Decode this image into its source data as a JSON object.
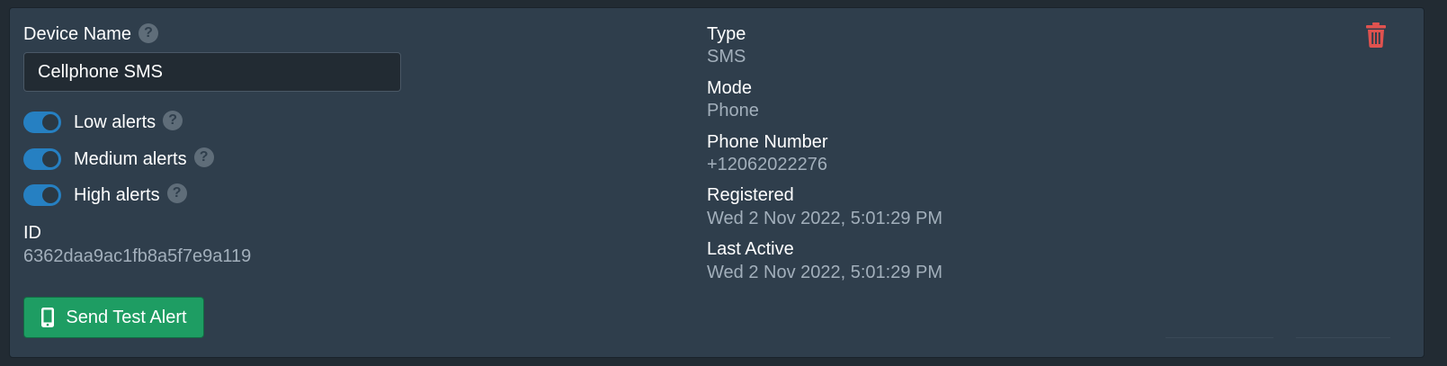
{
  "device": {
    "name_label": "Device Name",
    "name_value": "Cellphone SMS",
    "help_glyph": "?"
  },
  "alerts": [
    {
      "label": "Low alerts",
      "enabled": true
    },
    {
      "label": "Medium alerts",
      "enabled": true
    },
    {
      "label": "High alerts",
      "enabled": true
    }
  ],
  "id": {
    "label": "ID",
    "value": "6362daa9ac1fb8a5f7e9a119"
  },
  "send_button": {
    "label": "Send Test Alert",
    "icon": "mobile-phone-icon"
  },
  "details": {
    "type_label": "Type",
    "type_value": "SMS",
    "mode_label": "Mode",
    "mode_value": "Phone",
    "phone_label": "Phone Number",
    "phone_value": "+12062022276",
    "registered_label": "Registered",
    "registered_value": "Wed 2 Nov 2022, 5:01:29 PM",
    "last_active_label": "Last Active",
    "last_active_value": "Wed 2 Nov 2022, 5:01:29 PM"
  },
  "delete_icon": "trash-icon",
  "colors": {
    "background": "#222b33",
    "card": "#2f3e4c",
    "toggle_on": "#2680c2",
    "button_green": "#1e9d63",
    "trash_red": "#e0524f",
    "muted_text": "#a2afbb"
  }
}
